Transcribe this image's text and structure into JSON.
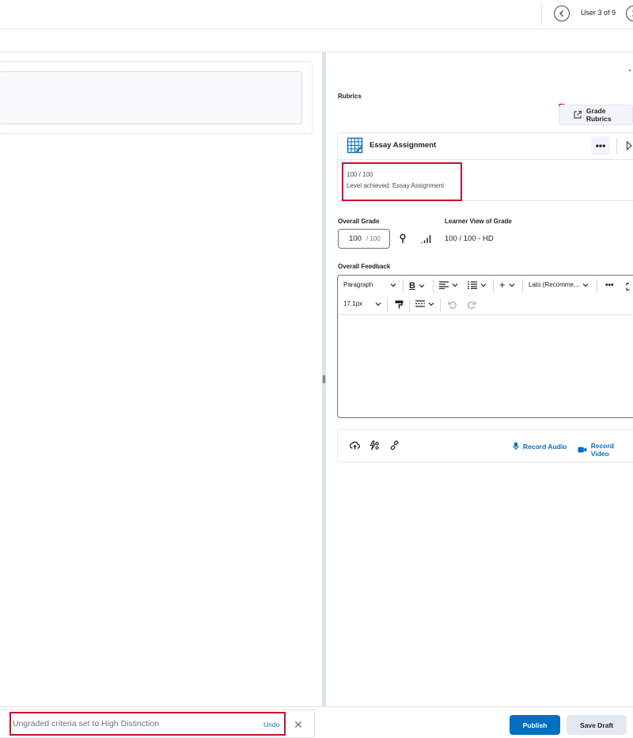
{
  "header": {
    "user_count": "User 3 of 9",
    "prev_icon": "chevron-left-icon",
    "next_icon": "chevron-right-icon"
  },
  "rubrics": {
    "section_label": "Rubrics",
    "grade_rubrics_label": "Grade Rubrics",
    "card": {
      "title": "Essay Assignment",
      "more_label": "•••",
      "score": "100 / 100",
      "level_achieved": "Level achieved: Essay Assignment"
    }
  },
  "grade": {
    "overall_label": "Overall Grade",
    "value": "100",
    "out_of": "/ 100",
    "learner_view_label": "Learner View of Grade",
    "learner_view_value": "100 / 100 - HD"
  },
  "feedback": {
    "label": "Overall Feedback",
    "toolbar": {
      "paragraph": "Paragraph",
      "font": "Lato (Recomme...",
      "size": "17.1px",
      "more": "•••"
    }
  },
  "attachments": {
    "record_audio": "Record Audio",
    "record_video": "Record Video"
  },
  "toast": {
    "message": "Ungraded criteria set to High Distinction",
    "undo": "Undo"
  },
  "actions": {
    "publish": "Publish",
    "save_draft": "Save Draft"
  },
  "colors": {
    "primary": "#006fbf",
    "highlight": "#c8102e"
  }
}
